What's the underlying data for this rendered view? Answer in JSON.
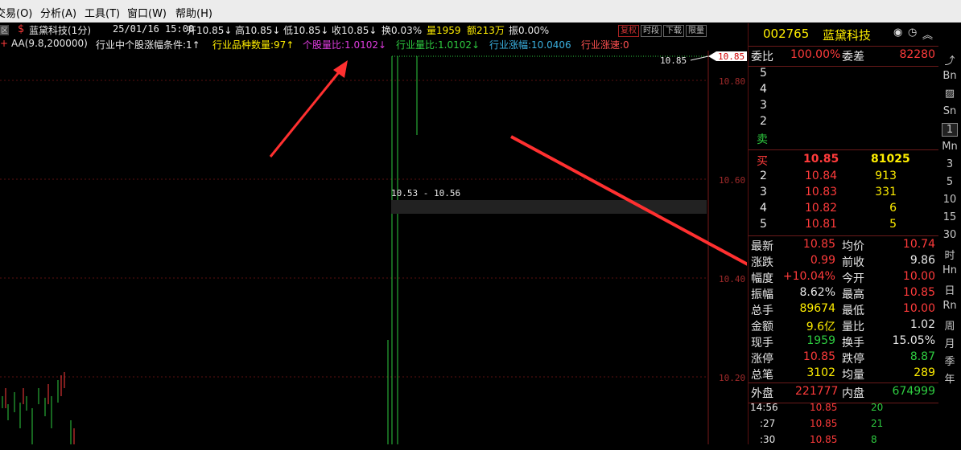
{
  "menu": [
    "交易(O)",
    "分析(A)",
    "工具(T)",
    "窗口(W)",
    "帮助(H)"
  ],
  "chart_header": {
    "badge": "区",
    "stock_name": "蓝黛科技(1分)",
    "datetime": "25/01/16 15:00",
    "open": "开10.85↓",
    "high": "高10.85↓",
    "low": "低10.85↓",
    "close": "收10.85↓",
    "turnover": "换0.03%",
    "volume": "量1959",
    "amount": "额213万",
    "amplitude": "振0.00%",
    "buttons": [
      "复权",
      "时段",
      "下载",
      "限量"
    ]
  },
  "indicator_line": {
    "name": "AA(9.8,200000)",
    "cond": "行业中个股涨幅条件:1↑",
    "count": "行业品种数量:97↑",
    "stock_ratio": "个股量比:1.0102↓",
    "ind_ratio": "行业量比:1.0102↓",
    "ind_change": "行业涨幅:10.0406",
    "ind_speed": "行业涨速:0"
  },
  "chart": {
    "price_axis": [
      "10.80",
      "10.60",
      "10.40",
      "10.20"
    ],
    "current_price_tag": "10.85",
    "price_label": "10.85",
    "range_label": "10.53 - 10.56"
  },
  "panel": {
    "code": "002765",
    "name": "蓝黛科技",
    "header_icons": [
      "target-icon",
      "clock-icon",
      "collapse-icon"
    ],
    "weibi_label": "委比",
    "weibi": "100.00%",
    "weicha_label": "委差",
    "weicha": "82280",
    "sell_levels": [
      "5",
      "4",
      "3",
      "2"
    ],
    "sell_label": "卖",
    "buy_label": "买",
    "buy_price": "10.85",
    "buy_vol": "81025",
    "buy_levels": [
      {
        "lvl": "2",
        "price": "10.84",
        "vol": "913"
      },
      {
        "lvl": "3",
        "price": "10.83",
        "vol": "331"
      },
      {
        "lvl": "4",
        "price": "10.82",
        "vol": "6"
      },
      {
        "lvl": "5",
        "price": "10.81",
        "vol": "5"
      }
    ],
    "stats": [
      {
        "l1": "最新",
        "v1": "10.85",
        "c1": "red",
        "l2": "均价",
        "v2": "10.74",
        "c2": "red"
      },
      {
        "l1": "涨跌",
        "v1": "0.99",
        "c1": "red",
        "l2": "前收",
        "v2": "9.86",
        "c2": "wht"
      },
      {
        "l1": "幅度",
        "v1": "+10.04%",
        "c1": "red",
        "l2": "今开",
        "v2": "10.00",
        "c2": "red"
      },
      {
        "l1": "振幅",
        "v1": "8.62%",
        "c1": "wht",
        "l2": "最高",
        "v2": "10.85",
        "c2": "red"
      },
      {
        "l1": "总手",
        "v1": "89674",
        "c1": "yellow",
        "l2": "最低",
        "v2": "10.00",
        "c2": "red"
      },
      {
        "l1": "金额",
        "v1": "9.6亿",
        "c1": "yellow",
        "l2": "量比",
        "v2": "1.02",
        "c2": "wht"
      },
      {
        "l1": "现手",
        "v1": "1959",
        "c1": "green",
        "l2": "换手",
        "v2": "15.05%",
        "c2": "wht"
      },
      {
        "l1": "涨停",
        "v1": "10.85",
        "c1": "red",
        "l2": "跌停",
        "v2": "8.87",
        "c2": "green"
      },
      {
        "l1": "总笔",
        "v1": "3102",
        "c1": "yellow",
        "l2": "均量",
        "v2": "289",
        "c2": "yellow"
      }
    ],
    "outer_label": "外盘",
    "outer": "221777",
    "inner_label": "内盘",
    "inner": "674999",
    "ticks": [
      {
        "t": "14:56",
        "p": "10.85",
        "v": "20"
      },
      {
        "t": ":27",
        "p": "10.85",
        "v": "21"
      },
      {
        "t": ":30",
        "p": "10.85",
        "v": "8"
      }
    ]
  },
  "toolbar": [
    "Bn",
    "Sn",
    "1",
    "Mn",
    "3",
    "5",
    "10",
    "15",
    "30",
    "时",
    "Hn",
    "日",
    "Rn",
    "周",
    "月",
    "季",
    "年"
  ]
}
